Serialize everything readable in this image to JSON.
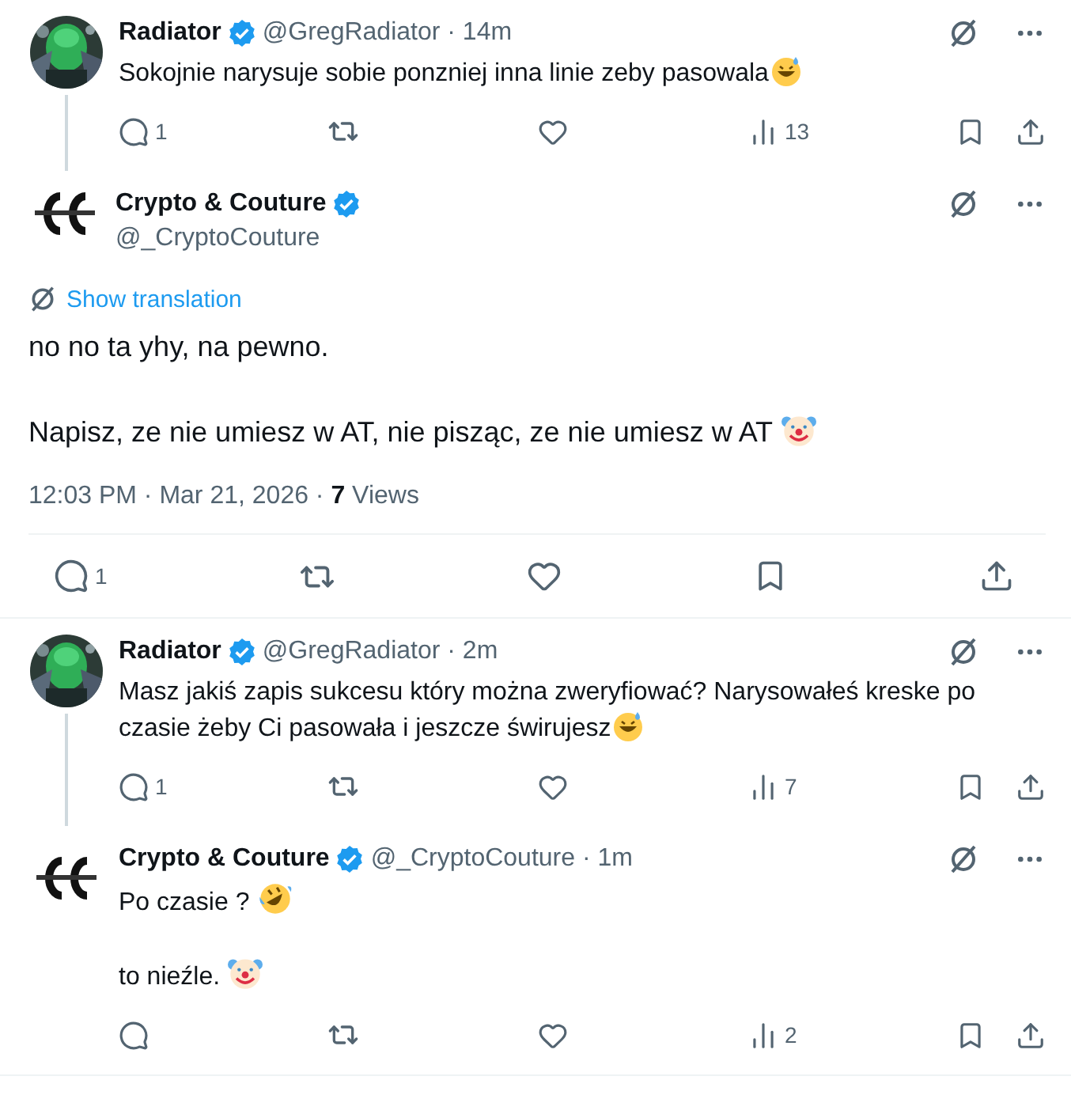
{
  "tweets": [
    {
      "kind": "reply",
      "author": {
        "name": "Radiator",
        "verified": true
      },
      "meta": "@GregRadiator · 14m",
      "paragraphs": [
        {
          "text": "Sokojnie narysuje sobie ponzniej inna linie zeby pasowala",
          "kind": "sweat"
        }
      ],
      "stats": {
        "replies": "1",
        "views": "13"
      },
      "thread_line": true
    },
    {
      "kind": "focal",
      "author": {
        "name": "Crypto & Couture",
        "verified": true,
        "kind": "logo"
      },
      "meta": "@_CryptoCouture",
      "translation": "Show translation",
      "paragraphs": [
        {
          "text": "no no ta yhy, na pewno.",
          "kind": "plain"
        },
        {
          "text": "Napisz, ze nie umiesz w AT, nie pisząc, ze nie umiesz w AT ",
          "kind": "clown"
        }
      ],
      "timestamp": "12:03 PM · Mar 21, 2026 · **7** Views",
      "stats": {
        "replies": "1"
      }
    },
    {
      "kind": "reply",
      "author": {
        "name": "Radiator",
        "verified": true
      },
      "meta": "@GregRadiator · 2m",
      "paragraphs": [
        {
          "text": "Masz jakiś zapis sukcesu który można zweryfiować? Narysowałeś kreske po czasie żeby Ci pasowała i jeszcze świrujesz",
          "kind": "sweat"
        }
      ],
      "stats": {
        "replies": "1",
        "views": "7"
      },
      "thread_line": true
    },
    {
      "kind": "reply",
      "author": {
        "name": "Crypto & Couture",
        "verified": true,
        "kind": "logo"
      },
      "meta": "@_CryptoCouture · 1m",
      "paragraphs": [
        {
          "text": "Po czasie ? ",
          "kind": "rofl"
        },
        {
          "text": "to nieźle. ",
          "kind": "clown"
        }
      ],
      "stats": {
        "views": "2"
      },
      "thread_line": false
    }
  ]
}
